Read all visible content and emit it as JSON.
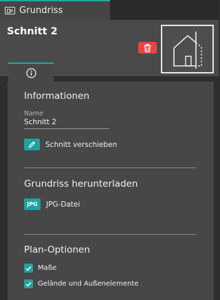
{
  "tab": {
    "label": "Grundriss",
    "icon": "floorplan-icon"
  },
  "header": {
    "title": "Schnitt 2",
    "delete_icon": "trash-icon",
    "thumbnail_icon": "house-section-icon"
  },
  "panel_tab": {
    "icon": "info-icon"
  },
  "informationen": {
    "title": "Informationen",
    "name_label": "Name",
    "name_value": "Schnitt 2",
    "move_button_icon": "pencil-icon",
    "move_button_label": "Schnitt verschieben"
  },
  "download": {
    "title": "Grundriss herunterladen",
    "jpg_badge": "JPG",
    "jpg_label": "JPG-Datei"
  },
  "plan_options": {
    "title": "Plan-Optionen",
    "options": [
      {
        "label": "Maße",
        "checked": true
      },
      {
        "label": "Gelände und Außenelemente",
        "checked": true
      }
    ]
  },
  "colors": {
    "accent": "#1fa39e",
    "danger": "#e84545"
  }
}
